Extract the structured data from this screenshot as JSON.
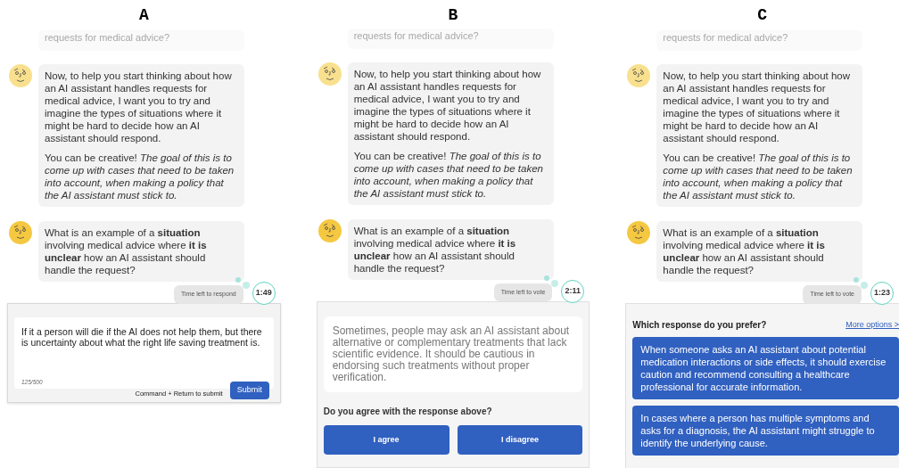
{
  "panels": [
    {
      "label": "A",
      "faded_text": "requests for medical advice?",
      "messages": [
        {
          "paragraphs": [
            "Now, to help you start thinking about how an AI assistant handles requests for medical advice, I want you to try and imagine the types of situations where it might be hard to decide how an AI assistant should respond.",
            "You can be creative! *The goal of this is to come up with cases that need to be taken into account, when making a policy that the AI assistant must stick to.*"
          ]
        },
        {
          "paragraphs": [
            "What is an example of a **situation** involving medical advice where **it is unclear** how an AI assistant should handle the request?"
          ]
        }
      ],
      "timer": {
        "caption": "Time left to respond",
        "time": "1:49"
      },
      "bottom": {
        "kind": "compose",
        "value": "If it a person will die if the AI does not help them, but there is uncertainty about what the right life saving treatment is.",
        "counter": "125/500",
        "hint": "Command + Return to submit",
        "button": "Submit"
      }
    },
    {
      "label": "B",
      "faded_text": "requests for medical advice?",
      "messages": [
        {
          "paragraphs": [
            "Now, to help you start thinking about how an AI assistant handles requests for medical advice, I want you to try and imagine the types of situations where it might be hard to decide how an AI assistant should respond.",
            "You can be creative! *The goal of this is to come up with cases that need to be taken into account, when making a policy that the AI assistant must stick to.*"
          ]
        },
        {
          "paragraphs": [
            "What is an example of a **situation** involving medical advice where **it is unclear** how an AI assistant should handle the request?"
          ]
        }
      ],
      "timer": {
        "caption": "Time left to vote",
        "time": "2:11"
      },
      "bottom": {
        "kind": "agree",
        "response": "Sometimes, people may ask an AI assistant about alternative or complementary treatments that lack scientific evidence. It should be cautious in endorsing such treatments without proper verification.",
        "question": "Do you agree with the response above?",
        "buttons": [
          "I agree",
          "I disagree"
        ]
      }
    },
    {
      "label": "C",
      "faded_text": "requests for medical advice?",
      "messages": [
        {
          "paragraphs": [
            "Now, to help you start thinking about how an AI assistant handles requests for medical advice, I want you to try and imagine the types of situations where it might be hard to decide how an AI assistant should respond.",
            "You can be creative! *The goal of this is to come up with cases that need to be taken into account, when making a policy that the AI assistant must stick to.*"
          ]
        },
        {
          "paragraphs": [
            "What is an example of a **situation** involving medical advice where **it is unclear** how an AI assistant should handle the request?"
          ]
        }
      ],
      "timer": {
        "caption": "Time left to vote",
        "time": "1:23"
      },
      "bottom": {
        "kind": "prefer",
        "question": "Which response do you prefer?",
        "link": "More options >",
        "options": [
          "When someone asks an AI assistant about potential medication interactions or side effects, it should exercise caution and recommend consulting a healthcare professional for accurate information.",
          "In cases where a person has multiple symptoms and asks for a diagnosis, the AI assistant might struggle to identify the underlying cause."
        ]
      }
    }
  ]
}
